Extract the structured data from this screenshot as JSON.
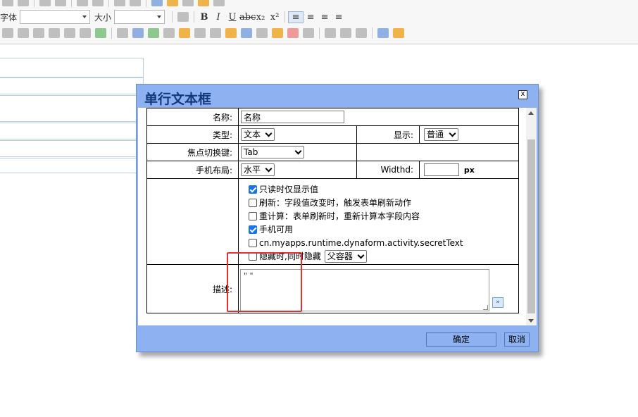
{
  "toolbar": {
    "font_label": "字体",
    "size_label": "大小",
    "font_value": "",
    "size_value": ""
  },
  "dialog": {
    "title": "单行文本框",
    "close": "x",
    "form": {
      "name_label": "名称:",
      "name_value": "名称",
      "type_label": "类型:",
      "type_value": "文本",
      "display_label": "显示:",
      "display_value": "普通",
      "focus_label": "焦点切换键:",
      "focus_value": "Tab",
      "mobile_layout_label": "手机布局:",
      "mobile_layout_value": "水平",
      "width_label": "Widthd:",
      "width_value": "",
      "width_unit": "px",
      "options": [
        {
          "label": "只读时仅显示值",
          "checked": true
        },
        {
          "label": "刷新：字段值改变时，触发表单刷新动作",
          "checked": false
        },
        {
          "label": "重计算：表单刷新时，重新计算本字段内容",
          "checked": false
        },
        {
          "label": "手机可用",
          "checked": true
        },
        {
          "label": "cn.myapps.runtime.dynaform.activity.secretText",
          "checked": false
        },
        {
          "label": "隐藏时,同时隐藏",
          "checked": false
        }
      ],
      "hide_container_value": "父容器",
      "desc_label": "描述:",
      "desc_value": "\"   \""
    },
    "buttons": {
      "ok": "确定",
      "cancel": "取消"
    }
  },
  "colors": {
    "dialog_frame": "#8eb1f2",
    "title_text": "#123a7c",
    "highlight": "#e53030",
    "checkbox": "#1a73e8"
  }
}
